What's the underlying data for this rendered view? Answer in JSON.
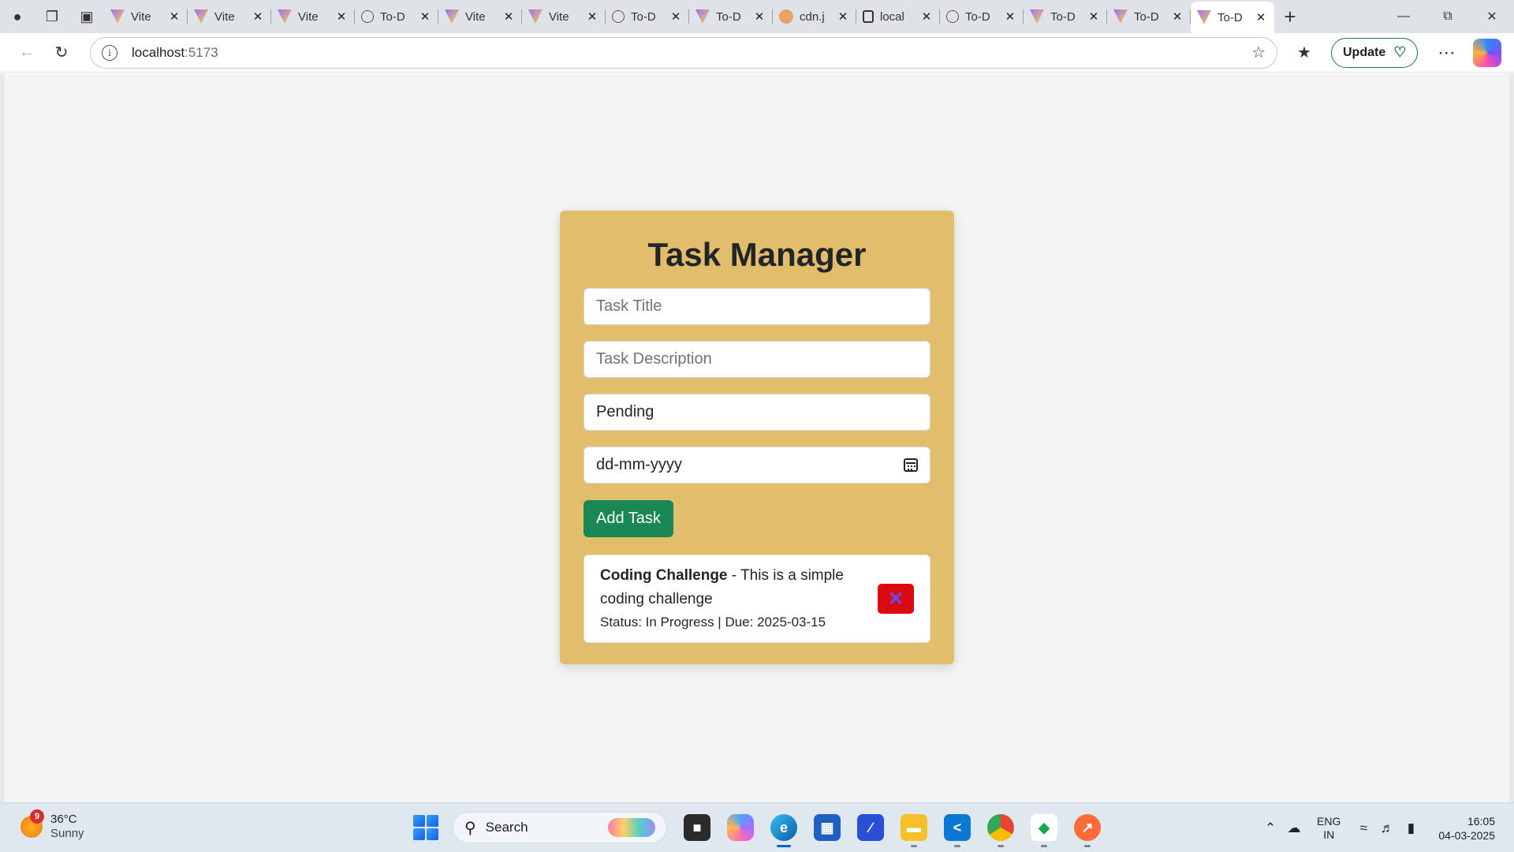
{
  "browser": {
    "tabs": [
      {
        "label": "Vite",
        "icon": "vite-icon"
      },
      {
        "label": "Vite",
        "icon": "vite-icon"
      },
      {
        "label": "Vite",
        "icon": "vite-icon"
      },
      {
        "label": "To-D",
        "icon": "globe-icon"
      },
      {
        "label": "Vite",
        "icon": "vite-icon"
      },
      {
        "label": "Vite",
        "icon": "vite-icon"
      },
      {
        "label": "To-D",
        "icon": "globe-icon"
      },
      {
        "label": "To-D",
        "icon": "vite-icon"
      },
      {
        "label": "cdn.j",
        "icon": "cdn-icon"
      },
      {
        "label": "local",
        "icon": "document-icon"
      },
      {
        "label": "To-D",
        "icon": "globe-icon"
      },
      {
        "label": "To-D",
        "icon": "vite-icon"
      },
      {
        "label": "To-D",
        "icon": "vite-icon"
      },
      {
        "label": "To-D",
        "icon": "vite-icon",
        "active": true
      }
    ],
    "address": {
      "host": "localhost",
      "port": ":5173"
    },
    "update_label": "Update"
  },
  "app": {
    "title": "Task Manager",
    "form": {
      "title_placeholder": "Task Title",
      "description_placeholder": "Task Description",
      "status_value": "Pending",
      "date_placeholder": "dd-mm-yyyy",
      "submit_label": "Add Task"
    },
    "tasks": [
      {
        "title": "Coding Challenge",
        "separator": " - ",
        "description": "This is a simple coding challenge",
        "status_label": "Status: ",
        "status": "In Progress",
        "meta_sep": " | ",
        "due_label": "Due: ",
        "due": "2025-03-15",
        "delete_glyph": "✕"
      }
    ],
    "colors": {
      "card": "#e2be6a",
      "add_button": "#198754",
      "delete_button": "#dc0b12"
    }
  },
  "taskbar": {
    "weather": {
      "badge": "9",
      "temp": "36°C",
      "condition": "Sunny"
    },
    "search_placeholder": "Search",
    "lang": {
      "line1": "ENG",
      "line2": "IN"
    },
    "clock": {
      "time": "16:05",
      "date": "04-03-2025"
    }
  }
}
